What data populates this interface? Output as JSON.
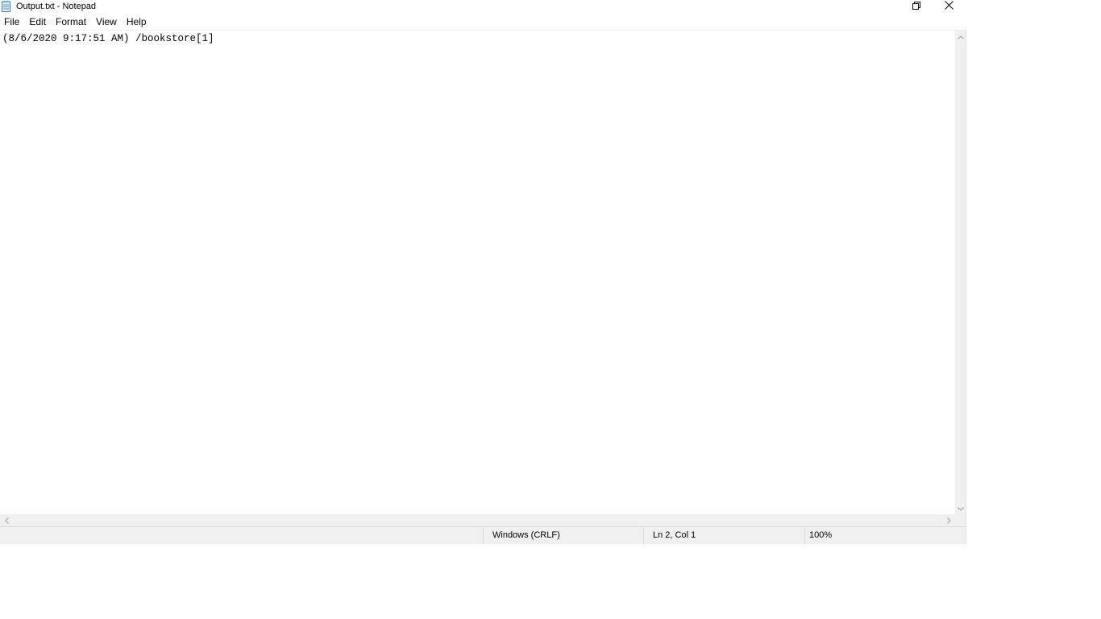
{
  "window": {
    "title": "Output.txt - Notepad",
    "app_icon": "notepad-icon",
    "controls": {
      "restore_icon": "restore-icon",
      "close_icon": "close-icon"
    }
  },
  "menu": {
    "items": [
      {
        "label": "File"
      },
      {
        "label": "Edit"
      },
      {
        "label": "Format"
      },
      {
        "label": "View"
      },
      {
        "label": "Help"
      }
    ]
  },
  "editor": {
    "content": "(8/6/2020 9:17:51 AM) /bookstore[1]"
  },
  "statusbar": {
    "encoding": "Windows (CRLF)",
    "position": "Ln 2, Col 1",
    "zoom": "100%"
  },
  "colors": {
    "chrome_bg": "#f0f0f0",
    "divider": "#dadada",
    "text": "#000000"
  }
}
